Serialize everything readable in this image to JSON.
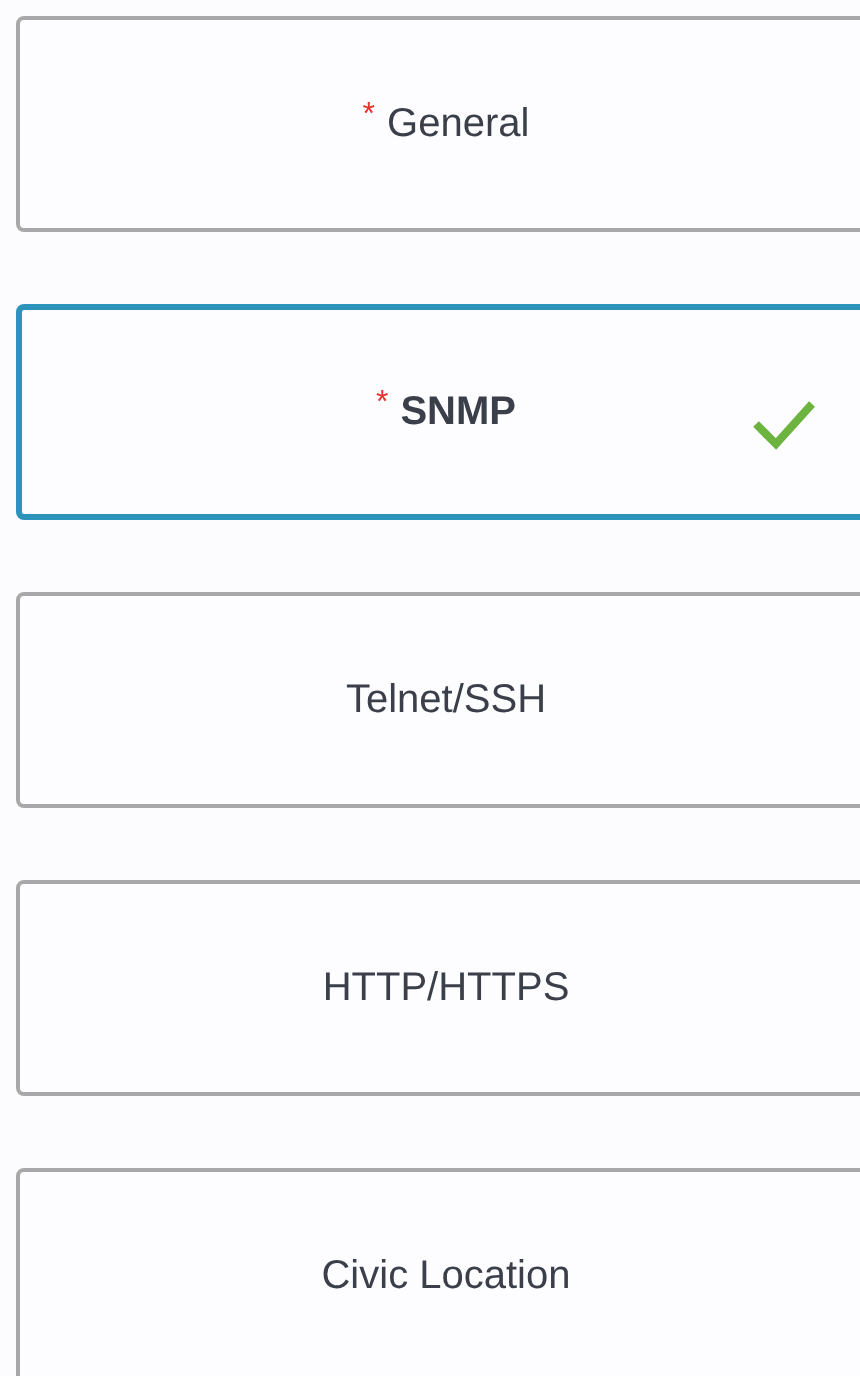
{
  "steps": [
    {
      "label": "General",
      "required_mark": "*",
      "selected": false,
      "complete": false
    },
    {
      "label": "SNMP",
      "required_mark": "*",
      "selected": true,
      "complete": true
    },
    {
      "label": "Telnet/SSH",
      "selected": false,
      "complete": false
    },
    {
      "label": "HTTP/HTTPS",
      "selected": false,
      "complete": false
    },
    {
      "label": "Civic Location",
      "selected": false,
      "complete": false
    }
  ]
}
